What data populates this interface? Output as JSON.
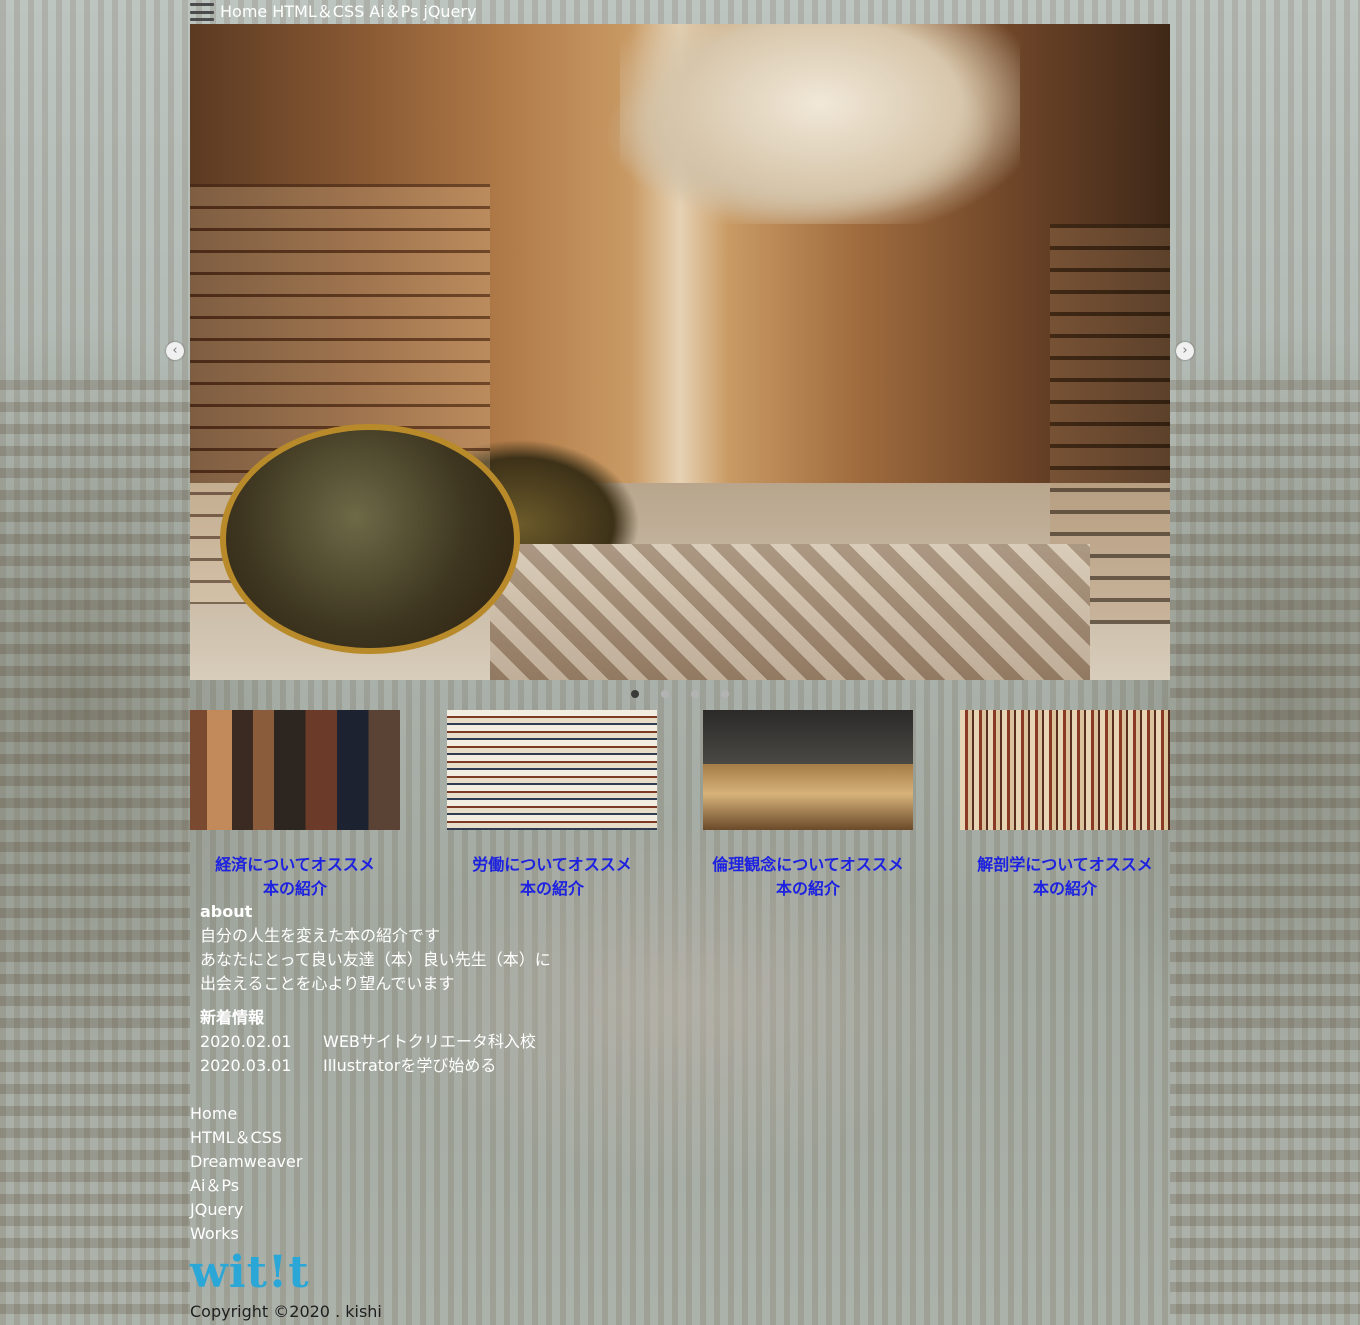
{
  "header": {
    "nav": [
      "Home",
      "HTML＆CSS",
      "Ai＆Ps",
      "jQuery"
    ]
  },
  "slider": {
    "prev_icon": "chevron-left-icon",
    "next_icon": "chevron-right-icon",
    "prev_glyph": "‹",
    "next_glyph": "›",
    "dots": 4,
    "active_dot": 0
  },
  "cards": [
    {
      "line1": "経済についてオススメ",
      "line2": "本の紹介"
    },
    {
      "line1": "労働についてオススメ",
      "line2": "本の紹介"
    },
    {
      "line1": "倫理観念についてオススメ",
      "line2": "本の紹介"
    },
    {
      "line1": "解剖学についてオススメ",
      "line2": "本の紹介"
    }
  ],
  "about": {
    "heading": "about",
    "lines": [
      "自分の人生を変えた本の紹介です",
      "あなたにとって良い友達（本）良い先生（本）に",
      "出会えることを心より望んでいます"
    ]
  },
  "news": {
    "heading": "新着情報",
    "items": [
      {
        "date": "2020.02.01",
        "text": "WEBサイトクリエータ科入校"
      },
      {
        "date": "2020.03.01",
        "text": "Illustratorを学び始める"
      }
    ]
  },
  "footer": {
    "nav": [
      "Home",
      "HTML＆CSS",
      "Dreamweaver",
      "Ai＆Ps",
      "JQuery",
      "Works"
    ],
    "logo": "wit!t",
    "copyright": "Copyright ©2020 .   kishi"
  },
  "colors": {
    "card_title": "#1d22e0",
    "logo": "#2aa7d6"
  }
}
